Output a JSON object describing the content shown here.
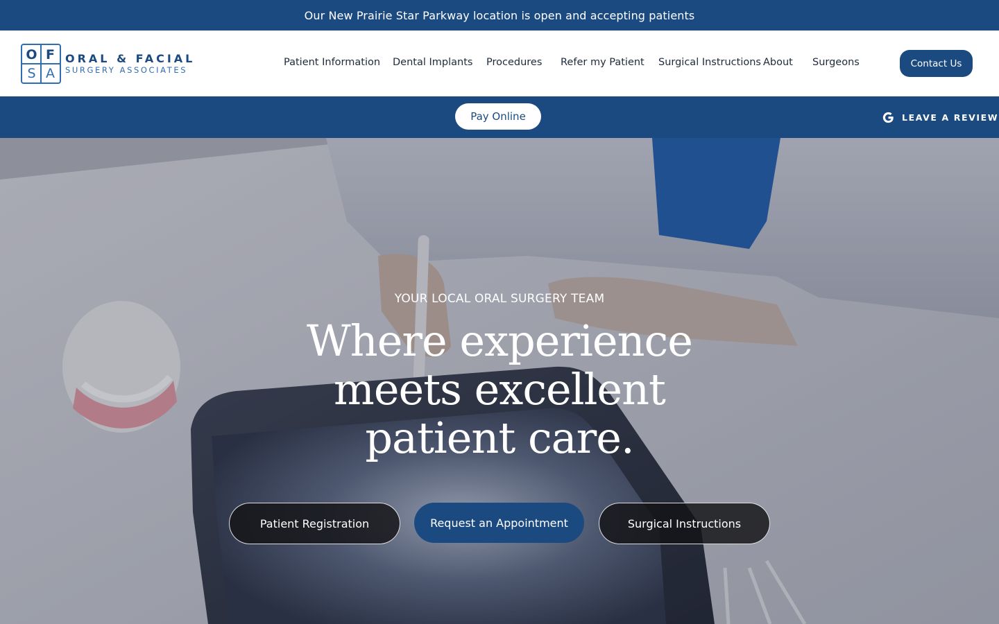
{
  "announcement": {
    "text": "Our New Prairie Star Parkway location is open and accepting patients"
  },
  "logo": {
    "letters": [
      "O",
      "F",
      "S",
      "A"
    ],
    "line1": "ORAL & FACIAL",
    "line2": "SURGERY ASSOCIATES"
  },
  "nav": {
    "items": [
      {
        "label": "Patient Information"
      },
      {
        "label": "Dental Implants"
      },
      {
        "label": "Procedures"
      },
      {
        "label": "Refer my Patient"
      },
      {
        "label": "Surgical Instructions"
      },
      {
        "label": "About"
      },
      {
        "label": "Surgeons"
      }
    ],
    "contact_label": "Contact Us"
  },
  "subbar": {
    "pay_label": "Pay Online",
    "review_label": "LEAVE A REVIEW",
    "review_icon": "google-icon"
  },
  "hero": {
    "eyebrow": "YOUR LOCAL ORAL SURGERY TEAM",
    "headline_lines": [
      "Where experience",
      "meets excellent",
      "patient care."
    ],
    "buttons": [
      {
        "label": "Patient Registration"
      },
      {
        "label": "Request an Appointment"
      },
      {
        "label": "Surgical Instructions"
      }
    ]
  },
  "colors": {
    "brand_blue": "#1b4a80",
    "logo_blue": "#2f6db3",
    "white": "#ffffff"
  }
}
